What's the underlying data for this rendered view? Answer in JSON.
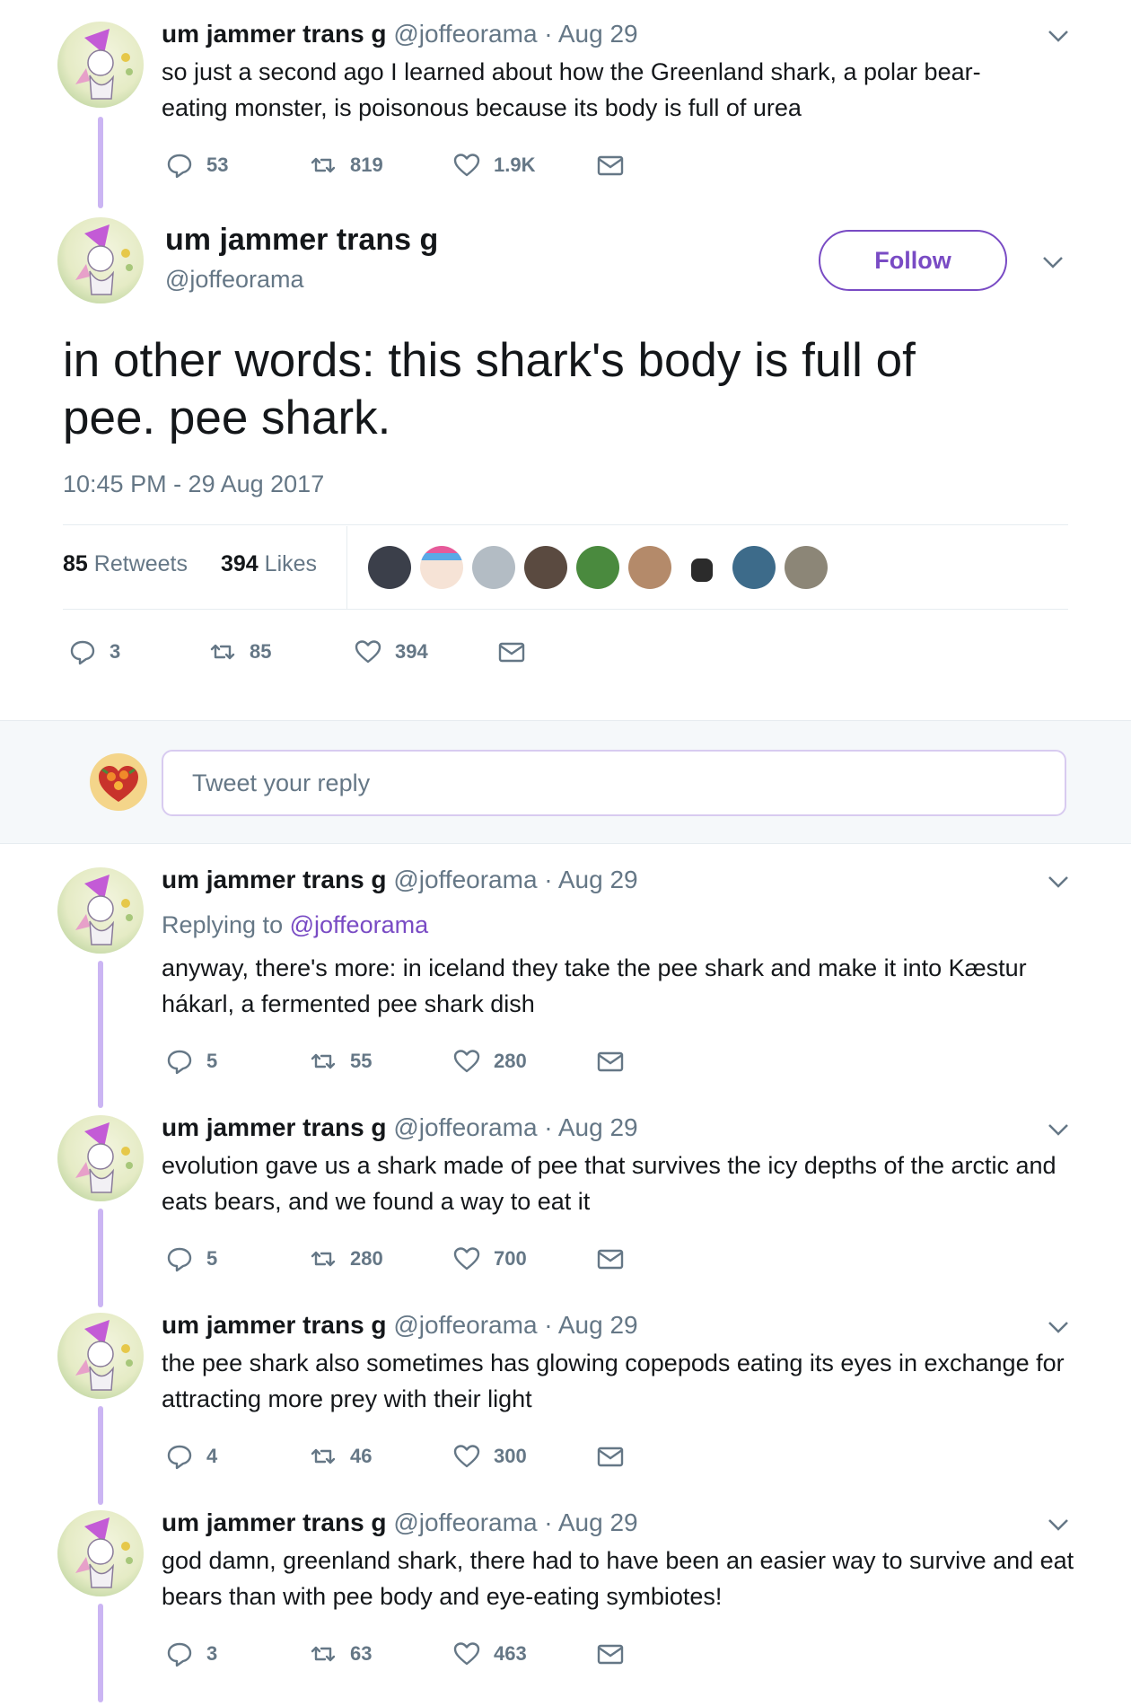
{
  "colors": {
    "accent": "#794bc4",
    "thread_line": "#cbb5f3",
    "secondary_text": "#657786",
    "primary_text": "#14171a"
  },
  "first_tweet": {
    "name": "um jammer trans g",
    "meta": "@joffeorama · Aug 29",
    "text": "so just a second ago I learned about how the Greenland shark, a polar bear-eating monster, is poisonous because its body is full of urea",
    "replies": "53",
    "retweets": "819",
    "likes": "1.9K"
  },
  "main_tweet": {
    "name": "um jammer trans g",
    "handle": "@joffeorama",
    "follow_label": "Follow",
    "text": "in other words: this shark's body is full of pee. pee shark.",
    "timestamp": "10:45 PM - 29 Aug 2017",
    "retweets_count": "85",
    "retweets_label": "Retweets",
    "likes_count": "394",
    "likes_label": "Likes",
    "liker_avatars": [
      "liker-1",
      "liker-2",
      "liker-3",
      "liker-4",
      "liker-5",
      "liker-6",
      "liker-7",
      "liker-8",
      "liker-9"
    ],
    "replies": "3",
    "retweets": "85",
    "likes": "394"
  },
  "reply_box": {
    "placeholder": "Tweet your reply"
  },
  "thread": [
    {
      "name": "um jammer trans g",
      "meta": "@joffeorama · Aug 29",
      "replying_prefix": "Replying to",
      "replying_handle": "@joffeorama",
      "text": "anyway, there's more: in iceland they take the pee shark and make it into Kæstur hákarl, a fermented pee shark dish",
      "replies": "5",
      "retweets": "55",
      "likes": "280"
    },
    {
      "name": "um jammer trans g",
      "meta": "@joffeorama · Aug 29",
      "text": "evolution gave us a shark made of pee that survives the icy depths of the arctic and eats bears, and we found a way to eat it",
      "replies": "5",
      "retweets": "280",
      "likes": "700"
    },
    {
      "name": "um jammer trans g",
      "meta": "@joffeorama · Aug 29",
      "text": "the pee shark also sometimes has glowing copepods eating its eyes in exchange for attracting more prey with their light",
      "replies": "4",
      "retweets": "46",
      "likes": "300"
    },
    {
      "name": "um jammer trans g",
      "meta": "@joffeorama · Aug 29",
      "text": "god damn, greenland shark, there had to have been an easier way to survive and eat bears than with pee body and eye-eating symbiotes!",
      "replies": "3",
      "retweets": "63",
      "likes": "463"
    }
  ]
}
